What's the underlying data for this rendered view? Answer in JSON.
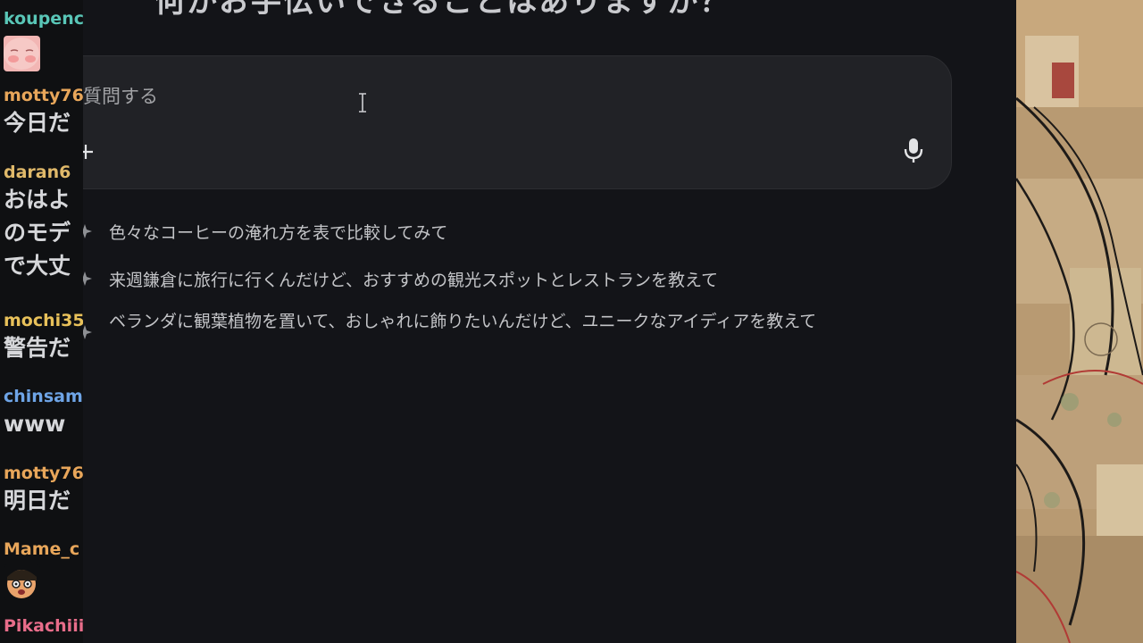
{
  "chat": {
    "messages": [
      {
        "user": "koupenc",
        "user_color": "#59c6b7",
        "emote": "pink-face-emote"
      },
      {
        "user": "motty76",
        "user_color": "#e8a65a",
        "text": "今日だ"
      },
      {
        "user": "daran6",
        "user_color": "#e0b96a",
        "text": "おはよ",
        "text2": "のモデ",
        "text3": "で大丈"
      },
      {
        "user": "mochi35",
        "user_color": "#e8c15a",
        "text": "警告だ"
      },
      {
        "user": "chinsam",
        "user_color": "#6ea4e6",
        "text": "www"
      },
      {
        "user": "motty76",
        "user_color": "#e8a65a",
        "text": "明日だ"
      },
      {
        "user": "Mame_c",
        "user_color": "#e8a65a",
        "emote": "cartoon-face-emote"
      },
      {
        "user": "Pikachiii",
        "user_color": "#e86d8a"
      }
    ]
  },
  "main": {
    "headline": "何かお手伝いできることはありますか？",
    "prompt": {
      "placeholder": "質問する"
    },
    "suggestions": [
      {
        "label": "色々なコーヒーの淹れ方を表で比較してみて"
      },
      {
        "label": "来週鎌倉に旅行に行くんだけど、おすすめの観光スポットとレストランを教えて"
      },
      {
        "label": "ベランダに観葉植物を置いて、おしゃれに飾りたいんだけど、ユニークなアイディアを教えて"
      }
    ]
  },
  "icons": {
    "plus": "plus-icon",
    "mic": "microphone-icon",
    "sparkle": "sparkle-icon",
    "cursor": "text-cursor-icon"
  },
  "colors": {
    "background": "#131418",
    "input_bg": "#212226",
    "text": "#c3c4c7",
    "placeholder": "#a2a3a6"
  }
}
